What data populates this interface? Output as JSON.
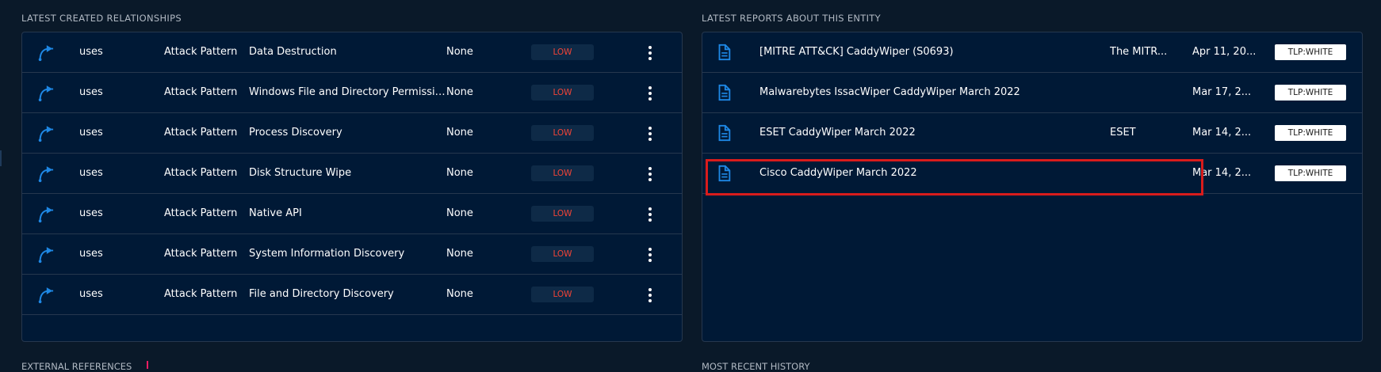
{
  "left_section": {
    "title": "LATEST CREATED RELATIONSHIPS",
    "rows": [
      {
        "type": "uses",
        "entity_type": "Attack Pattern",
        "name": "Data Destruction",
        "start": "None",
        "confidence": "LOW"
      },
      {
        "type": "uses",
        "entity_type": "Attack Pattern",
        "name": "Windows File and Directory Permissions ...",
        "start": "None",
        "confidence": "LOW"
      },
      {
        "type": "uses",
        "entity_type": "Attack Pattern",
        "name": "Process Discovery",
        "start": "None",
        "confidence": "LOW"
      },
      {
        "type": "uses",
        "entity_type": "Attack Pattern",
        "name": "Disk Structure Wipe",
        "start": "None",
        "confidence": "LOW"
      },
      {
        "type": "uses",
        "entity_type": "Attack Pattern",
        "name": "Native API",
        "start": "None",
        "confidence": "LOW"
      },
      {
        "type": "uses",
        "entity_type": "Attack Pattern",
        "name": "System Information Discovery",
        "start": "None",
        "confidence": "LOW"
      },
      {
        "type": "uses",
        "entity_type": "Attack Pattern",
        "name": "File and Directory Discovery",
        "start": "None",
        "confidence": "LOW"
      }
    ]
  },
  "right_section": {
    "title": "LATEST REPORTS ABOUT THIS ENTITY",
    "rows": [
      {
        "name": "[MITRE ATT&CK] CaddyWiper (S0693)",
        "author": "The MITR...",
        "date": "Apr 11, 20...",
        "marking": "TLP:WHITE"
      },
      {
        "name": "Malwarebytes IssacWiper CaddyWiper March 2022",
        "author": "",
        "date": "Mar 17, 2...",
        "marking": "TLP:WHITE"
      },
      {
        "name": "ESET CaddyWiper March 2022",
        "author": "ESET",
        "date": "Mar 14, 2...",
        "marking": "TLP:WHITE"
      },
      {
        "name": "Cisco CaddyWiper March 2022",
        "author": "",
        "date": "Mar 14, 2...",
        "marking": "TLP:WHITE"
      }
    ]
  },
  "bottom": {
    "left_title": "EXTERNAL REFERENCES",
    "right_title": "MOST RECENT HISTORY"
  },
  "colors": {
    "background": "#0a1929",
    "panel": "#001936",
    "accent": "#1e88e5",
    "confidence_low": "#f44336",
    "highlight": "#d91c1c"
  },
  "icons": {
    "relationship": "relationship-arrow-icon",
    "report": "report-document-icon",
    "menu": "more-vert-icon"
  }
}
